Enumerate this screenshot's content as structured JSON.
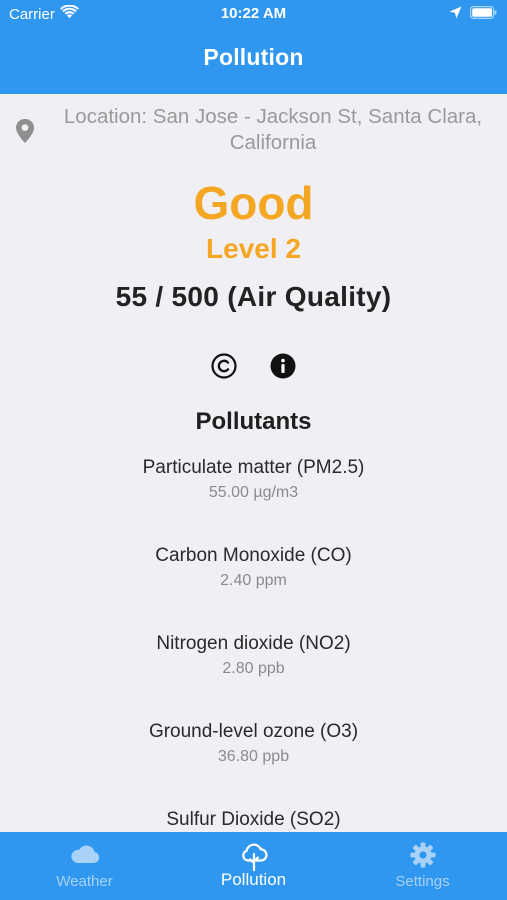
{
  "status_bar": {
    "carrier": "Carrier",
    "time": "10:22 AM",
    "icons": [
      "wifi-icon",
      "location-arrow-icon",
      "battery-icon"
    ]
  },
  "nav": {
    "title": "Pollution"
  },
  "location": {
    "icon": "map-pin-icon",
    "text": "Location: San Jose - Jackson St, Santa Clara, California"
  },
  "air_quality": {
    "status": "Good",
    "level": "Level 2",
    "index_text": "55 / 500 (Air Quality)",
    "status_color": "#f5a623"
  },
  "info_icons": [
    "copyright-icon",
    "info-icon"
  ],
  "pollutants": {
    "heading": "Pollutants",
    "items": [
      {
        "name": "Particulate matter (PM2.5)",
        "value": "55.00 µg/m3"
      },
      {
        "name": "Carbon Monoxide (CO)",
        "value": "2.40 ppm"
      },
      {
        "name": "Nitrogen dioxide (NO2)",
        "value": "2.80 ppb"
      },
      {
        "name": "Ground-level ozone (O3)",
        "value": "36.80 ppb"
      },
      {
        "name": "Sulfur Dioxide (SO2)",
        "value": ""
      }
    ]
  },
  "tabs": [
    {
      "label": "Weather",
      "icon": "cloud-icon",
      "active": false
    },
    {
      "label": "Pollution",
      "icon": "tree-icon",
      "active": true
    },
    {
      "label": "Settings",
      "icon": "gear-icon",
      "active": false
    }
  ],
  "colors": {
    "brand": "#2f97f0",
    "background": "#efeff4",
    "accent": "#f5a623",
    "tab_inactive": "#a8d2f8"
  }
}
